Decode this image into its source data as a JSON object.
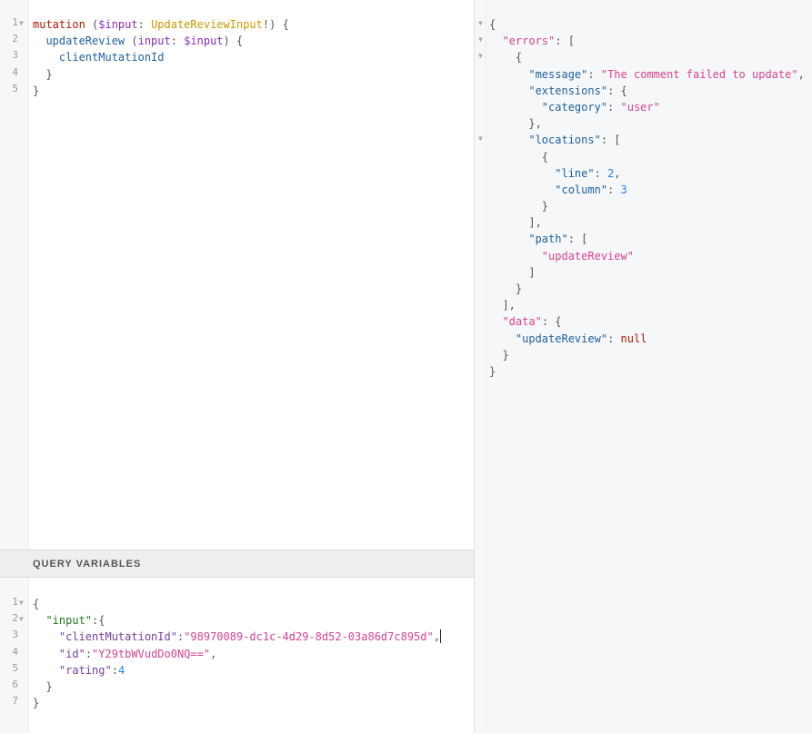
{
  "query_editor": {
    "line_numbers": [
      "1",
      "2",
      "3",
      "4",
      "5"
    ],
    "tokens": {
      "mutation_kw": "mutation",
      "open_paren": " (",
      "input_var": "$input",
      "colon": ": ",
      "input_type": "UpdateReviewInput",
      "close_sig": "!) {",
      "field_update": "updateReview",
      "arg_open": " (",
      "arg_name": "input",
      "arg_colon": ": ",
      "arg_var": "$input",
      "arg_close": ") {",
      "field_client": "clientMutationId",
      "brace_inner": "}",
      "brace_outer": "}"
    }
  },
  "variables_panel": {
    "title": "QUERY VARIABLES",
    "line_numbers": [
      "1",
      "2",
      "3",
      "4",
      "5",
      "6",
      "7"
    ],
    "tokens": {
      "open": "{",
      "input_key": "\"input\"",
      "input_sep": ":{",
      "cmid_key": "\"clientMutationId\"",
      "cmid_val": "\"98970089-dc1c-4d29-8d52-03a86d7c895d\"",
      "id_key": "\"id\"",
      "id_val": "\"Y29tbWVudDo0NQ==\"",
      "rating_key": "\"rating\"",
      "rating_val": "4",
      "close_inner": "}",
      "close_outer": "}"
    }
  },
  "result_viewer": {
    "tokens": {
      "open": "{",
      "errors_key": "\"errors\"",
      "errors_sep": ": [",
      "obj_open": "{",
      "message_key": "\"message\"",
      "message_val": "\"The comment failed to update\"",
      "extensions_key": "\"extensions\"",
      "category_key": "\"category\"",
      "category_val": "\"user\"",
      "ext_close": "},",
      "locations_key": "\"locations\"",
      "loc_obj_open": "{",
      "line_key": "\"line\"",
      "line_val": "2",
      "column_key": "\"column\"",
      "column_val": "3",
      "loc_obj_close": "}",
      "loc_close": "],",
      "path_key": "\"path\"",
      "path_val": "\"updateReview\"",
      "path_close": "]",
      "obj_close": "}",
      "errors_close": "],",
      "data_key": "\"data\"",
      "update_key": "\"updateReview\"",
      "update_val": "null",
      "data_close": "}",
      "close": "}"
    }
  }
}
